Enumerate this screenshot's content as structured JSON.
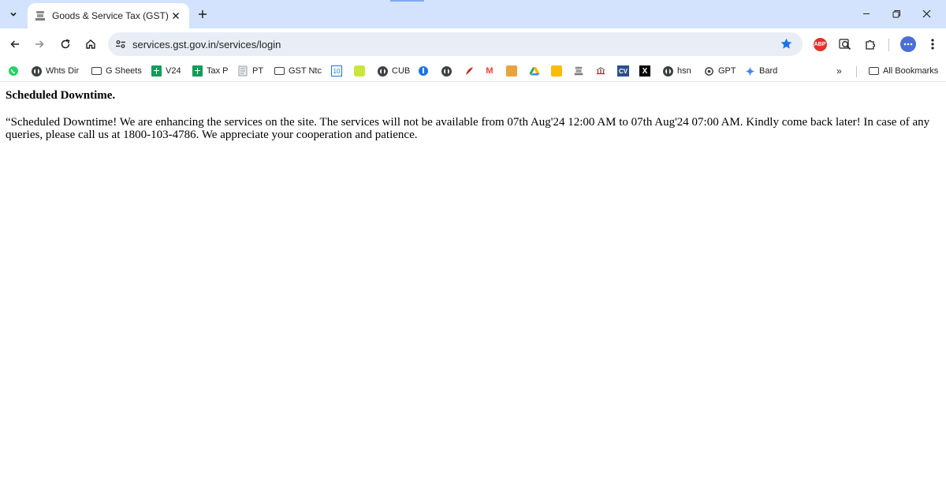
{
  "browser": {
    "tab": {
      "title": "Goods & Service Tax (GST)",
      "favicon": "emblem-icon"
    },
    "new_tab_symbol": "+",
    "url": "services.gst.gov.in/services/login",
    "extensions": {
      "abp_label": "ABP"
    },
    "colors": {
      "tabstrip": "#d3e3fd",
      "omnibox": "#e9eef6",
      "star": "#1a73e8",
      "abp": "#e0322e"
    }
  },
  "bookmarks": {
    "items": [
      {
        "label": ""
      },
      {
        "label": "Whts Dir"
      },
      {
        "label": "G Sheets"
      },
      {
        "label": "V24"
      },
      {
        "label": "Tax P"
      },
      {
        "label": "PT"
      },
      {
        "label": "GST Ntc"
      },
      {
        "label": "10"
      },
      {
        "label": ""
      },
      {
        "label": "CUB"
      },
      {
        "label": ""
      },
      {
        "label": ""
      },
      {
        "label": ""
      },
      {
        "label": "M"
      },
      {
        "label": ""
      },
      {
        "label": ""
      },
      {
        "label": ""
      },
      {
        "label": ""
      },
      {
        "label": ""
      },
      {
        "label": "CV"
      },
      {
        "label": "X"
      },
      {
        "label": "hsn"
      },
      {
        "label": "GPT"
      },
      {
        "label": "Bard"
      }
    ],
    "overflow": "»",
    "all_bookmarks": "All Bookmarks"
  },
  "page": {
    "heading": "Scheduled Downtime.",
    "message": "“Scheduled Downtime! We are enhancing the services on the site. The services will not be available from 07th Aug'24 12:00 AM to 07th Aug'24 07:00 AM. Kindly come back later! In case of any queries, please call us at 1800-103-4786. We appreciate your cooperation and patience."
  }
}
